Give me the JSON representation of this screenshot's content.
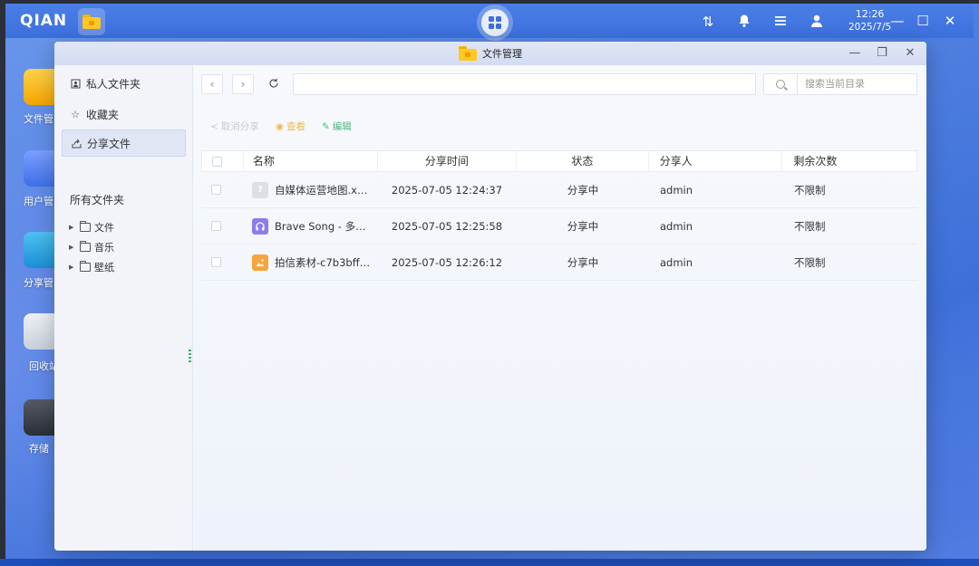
{
  "taskbar": {
    "logo": "QIAN",
    "clock_time": "12:26",
    "clock_date": "2025/7/5"
  },
  "desktop_icons": [
    {
      "label": "文件管",
      "icon": "folder-icon"
    },
    {
      "label": "用户管",
      "icon": "user-icon"
    },
    {
      "label": "分享管",
      "icon": "share-icon"
    },
    {
      "label": "回收站",
      "icon": "recycle-icon"
    },
    {
      "label": "存储",
      "icon": "storage-icon"
    }
  ],
  "window": {
    "title": "文件管理"
  },
  "sidebar": {
    "items": [
      {
        "label": "私人文件夹",
        "icon": "private-folder-icon"
      },
      {
        "label": "收藏夹",
        "icon": "star-icon"
      },
      {
        "label": "分享文件",
        "icon": "share-icon"
      }
    ],
    "all_folders_header": "所有文件夹",
    "tree": [
      {
        "label": "文件"
      },
      {
        "label": "音乐"
      },
      {
        "label": "壁纸"
      }
    ]
  },
  "search": {
    "placeholder": "搜索当前目录"
  },
  "toolbar": {
    "cancel_share": "取消分享",
    "view": "查看",
    "edit": "编辑"
  },
  "table": {
    "headers": {
      "name": "名称",
      "share_time": "分享时间",
      "status": "状态",
      "sharer": "分享人",
      "remaining": "剩余次数"
    },
    "rows": [
      {
        "name": "自媒体运营地图.x…",
        "icon": "unknown-file-icon",
        "time": "2025-07-05 12:24:37",
        "status": "分享中",
        "sharer": "admin",
        "remaining": "不限制"
      },
      {
        "name": "Brave Song - 多田…",
        "icon": "audio-file-icon",
        "time": "2025-07-05 12:25:58",
        "status": "分享中",
        "sharer": "admin",
        "remaining": "不限制"
      },
      {
        "name": "拍信素材-c7b3bff…",
        "icon": "image-file-icon",
        "time": "2025-07-05 12:26:12",
        "status": "分享中",
        "sharer": "admin",
        "remaining": "不限制"
      }
    ]
  }
}
